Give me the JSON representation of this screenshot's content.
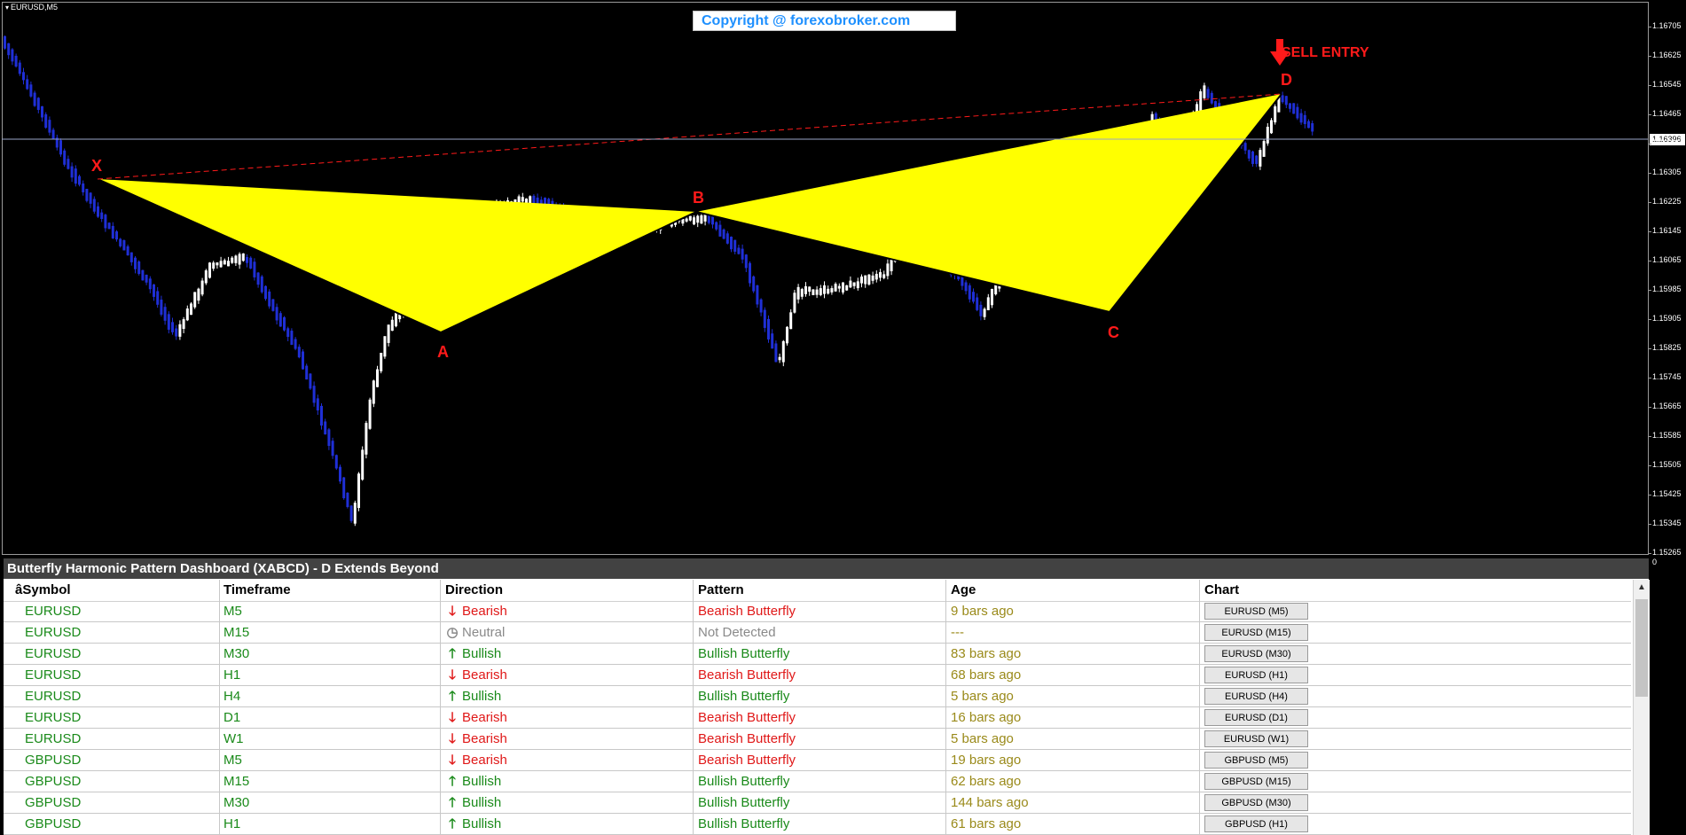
{
  "chart": {
    "symbol": "EURUSD,M5",
    "copyright": "Copyright @ forexobroker.com",
    "sell_entry": "SELL ENTRY",
    "points": {
      "x": "X",
      "a": "A",
      "b": "B",
      "c": "C",
      "d": "D"
    },
    "current_price": "1.16396",
    "price_ticks": [
      "1.16705",
      "1.16625",
      "1.16545",
      "1.16465",
      "1.16385",
      "1.16305",
      "1.16225",
      "1.16145",
      "1.16065",
      "1.15985",
      "1.15905",
      "1.15825",
      "1.15745",
      "1.15665",
      "1.15585",
      "1.15505",
      "1.15425",
      "1.15345",
      "1.15265"
    ],
    "scale_zero": "0",
    "colors": {
      "pattern_fill": "#ffff00",
      "bull_candle": "#ffffff",
      "bear_candle": "#1f2fd6",
      "label": "#ff1a1a"
    }
  },
  "dashboard": {
    "title": "Butterfly Harmonic Pattern Dashboard (XABCD) - D Extends Beyond",
    "headers": {
      "symbol": "âSymbol",
      "timeframe": "Timeframe",
      "direction": "Direction",
      "pattern": "Pattern",
      "age": "Age",
      "chart": "Chart"
    },
    "rows": [
      {
        "symbol": "EURUSD",
        "timeframe": "M5",
        "direction": "Bearish",
        "dir_type": "bear",
        "pattern": "Bearish Butterfly",
        "age": "9 bars ago",
        "chart": "EURUSD (M5)"
      },
      {
        "symbol": "EURUSD",
        "timeframe": "M15",
        "direction": "Neutral",
        "dir_type": "neut",
        "pattern": "Not Detected",
        "age": "---",
        "chart": "EURUSD (M15)"
      },
      {
        "symbol": "EURUSD",
        "timeframe": "M30",
        "direction": "Bullish",
        "dir_type": "bull",
        "pattern": "Bullish Butterfly",
        "age": "83 bars ago",
        "chart": "EURUSD (M30)"
      },
      {
        "symbol": "EURUSD",
        "timeframe": "H1",
        "direction": "Bearish",
        "dir_type": "bear",
        "pattern": "Bearish Butterfly",
        "age": "68 bars ago",
        "chart": "EURUSD (H1)"
      },
      {
        "symbol": "EURUSD",
        "timeframe": "H4",
        "direction": "Bullish",
        "dir_type": "bull",
        "pattern": "Bullish Butterfly",
        "age": "5 bars ago",
        "chart": "EURUSD (H4)"
      },
      {
        "symbol": "EURUSD",
        "timeframe": "D1",
        "direction": "Bearish",
        "dir_type": "bear",
        "pattern": "Bearish Butterfly",
        "age": "16 bars ago",
        "chart": "EURUSD (D1)"
      },
      {
        "symbol": "EURUSD",
        "timeframe": "W1",
        "direction": "Bearish",
        "dir_type": "bear",
        "pattern": "Bearish Butterfly",
        "age": "5 bars ago",
        "chart": "EURUSD (W1)"
      },
      {
        "symbol": "GBPUSD",
        "timeframe": "M5",
        "direction": "Bearish",
        "dir_type": "bear",
        "pattern": "Bearish Butterfly",
        "age": "19 bars ago",
        "chart": "GBPUSD (M5)"
      },
      {
        "symbol": "GBPUSD",
        "timeframe": "M15",
        "direction": "Bullish",
        "dir_type": "bull",
        "pattern": "Bullish Butterfly",
        "age": "62 bars ago",
        "chart": "GBPUSD (M15)"
      },
      {
        "symbol": "GBPUSD",
        "timeframe": "M30",
        "direction": "Bullish",
        "dir_type": "bull",
        "pattern": "Bullish Butterfly",
        "age": "144 bars ago",
        "chart": "GBPUSD (M30)"
      },
      {
        "symbol": "GBPUSD",
        "timeframe": "H1",
        "direction": "Bullish",
        "dir_type": "bull",
        "pattern": "Bullish Butterfly",
        "age": "61 bars ago",
        "chart": "GBPUSD (H1)"
      }
    ]
  }
}
